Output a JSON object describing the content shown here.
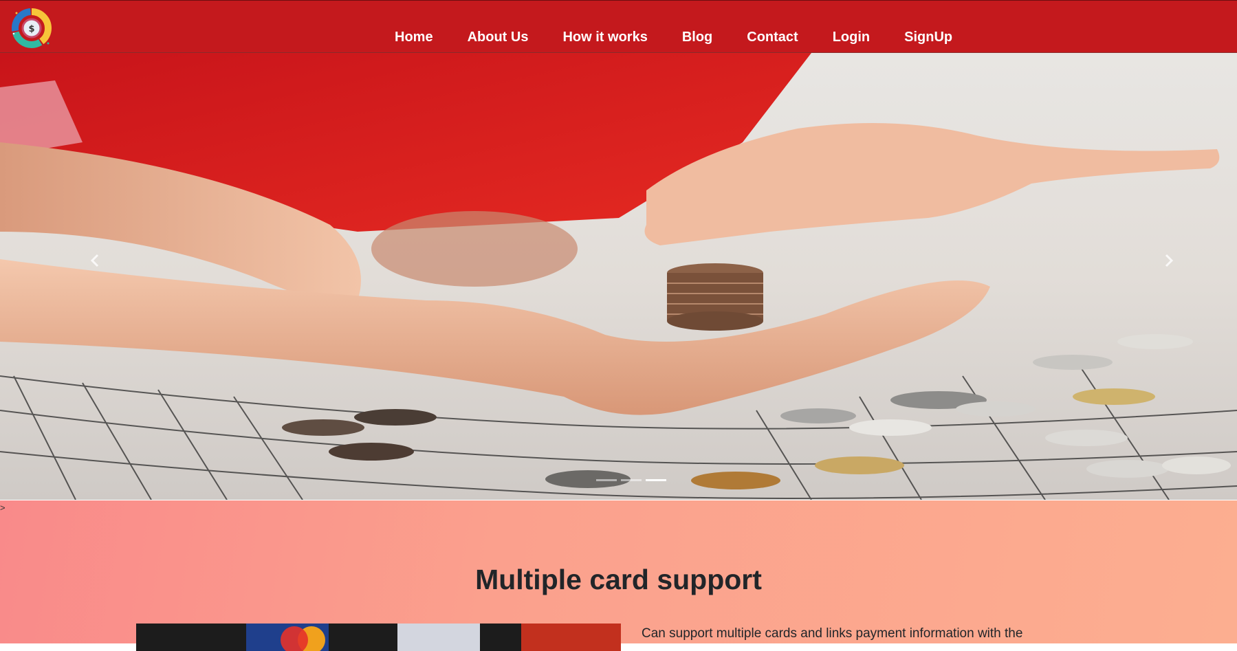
{
  "header": {
    "logo_icon": "dollar-chart-logo-icon",
    "nav": [
      {
        "label": "Home"
      },
      {
        "label": "About Us"
      },
      {
        "label": "How it works"
      },
      {
        "label": "Blog"
      },
      {
        "label": "Contact"
      },
      {
        "label": "Login"
      },
      {
        "label": "SignUp"
      }
    ],
    "colors": {
      "bar": "#c4191d",
      "text": "#ffffff"
    }
  },
  "carousel": {
    "prev_icon": "chevron-left-icon",
    "next_icon": "chevron-right-icon",
    "slide_count": 3,
    "active_slide": 3
  },
  "stray_text": ">",
  "feature": {
    "title": "Multiple card support",
    "text": "Can support multiple cards and links payment information with the",
    "colors": {
      "gradient_start": "#f98a8a",
      "gradient_end": "#fcae90"
    }
  }
}
